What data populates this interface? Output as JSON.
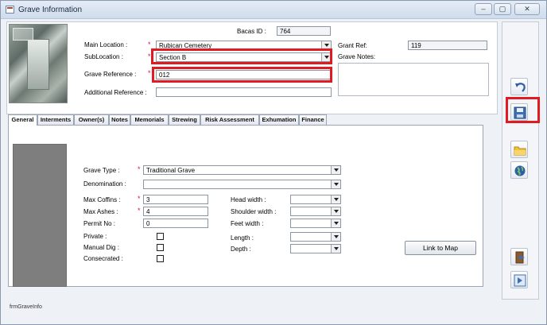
{
  "window": {
    "title": "Grave Information",
    "min_label": "–",
    "restore_label": "▢",
    "close_label": "✕"
  },
  "header": {
    "bacas_id_label": "Bacas ID :",
    "bacas_id_value": "764",
    "main_location_label": "Main Location :",
    "main_location_value": "Rubican Cemetery",
    "sub_location_label": "SubLocation :",
    "sub_location_value": "Section B",
    "grave_reference_label": "Grave Reference :",
    "grave_reference_value": "012",
    "additional_reference_label": "Additional Reference :",
    "additional_reference_value": "",
    "grant_ref_label": "Grant Ref:",
    "grant_ref_value": "119",
    "grave_notes_label": "Grave Notes:",
    "required_mark": "*"
  },
  "tabs": [
    {
      "label": "General",
      "active": true
    },
    {
      "label": "Interments"
    },
    {
      "label": "Owner(s)"
    },
    {
      "label": "Notes"
    },
    {
      "label": "Memorials"
    },
    {
      "label": "Strewing"
    },
    {
      "label": "Risk Assessment"
    },
    {
      "label": "Exhumation"
    },
    {
      "label": "Finance"
    }
  ],
  "general": {
    "grave_type_label": "Grave Type :",
    "grave_type_value": "Traditional Grave",
    "denomination_label": "Denomination :",
    "denomination_value": "",
    "max_coffins_label": "Max Coffins :",
    "max_coffins_value": "3",
    "max_ashes_label": "Max Ashes :",
    "max_ashes_value": "4",
    "permit_no_label": "Permit No :",
    "permit_no_value": "0",
    "private_label": "Private :",
    "manual_dig_label": "Manual Dig :",
    "consecrated_label": "Consecrated :",
    "head_width_label": "Head width :",
    "shoulder_width_label": "Shoulder width :",
    "feet_width_label": "Feet width :",
    "length_label": "Length :",
    "depth_label": "Depth :",
    "link_to_map_label": "Link to Map"
  },
  "footer": {
    "form_name": "frmGraveInfo"
  },
  "colors": {
    "highlight": "#e01b22",
    "required": "#d0145a"
  },
  "icons": {
    "undo": "undo-arrow-icon",
    "save": "save-disk-icon",
    "open": "folder-icon",
    "web": "globe-icon",
    "exit": "exit-door-icon",
    "next": "next-record-icon"
  }
}
